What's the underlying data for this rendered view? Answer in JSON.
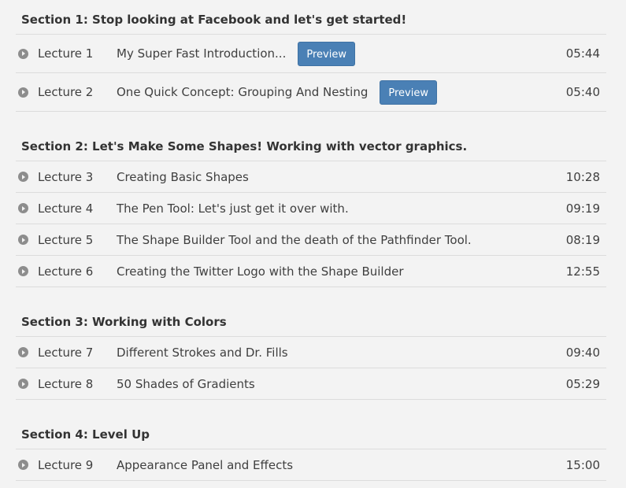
{
  "preview_label": "Preview",
  "sections": [
    {
      "title": "Section 1: Stop looking at Facebook and let's get started!",
      "lectures": [
        {
          "number": "Lecture 1",
          "title": "My Super Fast Introduction...",
          "duration": "05:44",
          "preview": true
        },
        {
          "number": "Lecture 2",
          "title": "One Quick Concept: Grouping And Nesting",
          "duration": "05:40",
          "preview": true
        }
      ]
    },
    {
      "title": "Section 2: Let's Make Some Shapes! Working with vector graphics.",
      "lectures": [
        {
          "number": "Lecture 3",
          "title": "Creating Basic Shapes",
          "duration": "10:28",
          "preview": false
        },
        {
          "number": "Lecture 4",
          "title": "The Pen Tool: Let's just get it over with.",
          "duration": "09:19",
          "preview": false
        },
        {
          "number": "Lecture 5",
          "title": "The Shape Builder Tool and the death of the Pathfinder Tool.",
          "duration": "08:19",
          "preview": false
        },
        {
          "number": "Lecture 6",
          "title": "Creating the Twitter Logo with the Shape Builder",
          "duration": "12:55",
          "preview": false
        }
      ]
    },
    {
      "title": "Section 3: Working with Colors",
      "lectures": [
        {
          "number": "Lecture 7",
          "title": "Different Strokes and Dr. Fills",
          "duration": "09:40",
          "preview": false
        },
        {
          "number": "Lecture 8",
          "title": "50 Shades of Gradients",
          "duration": "05:29",
          "preview": false
        }
      ]
    },
    {
      "title": "Section 4: Level Up",
      "lectures": [
        {
          "number": "Lecture 9",
          "title": "Appearance Panel and Effects",
          "duration": "15:00",
          "preview": false
        }
      ]
    }
  ]
}
